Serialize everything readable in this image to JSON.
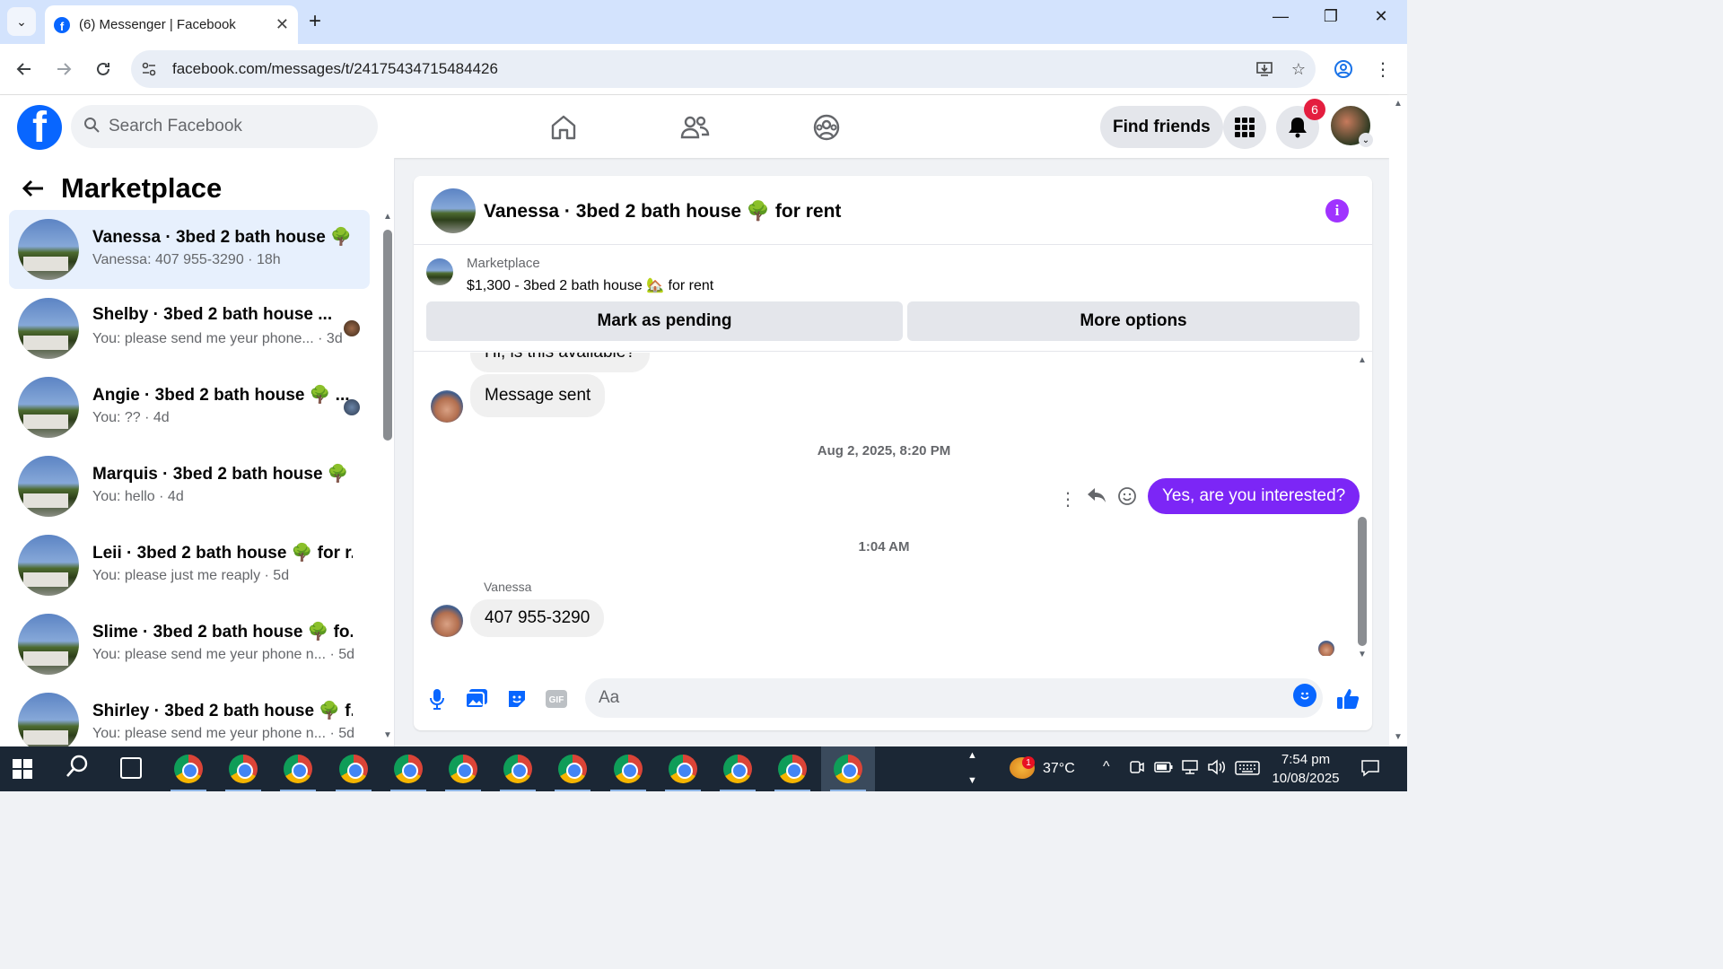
{
  "browser": {
    "tab_title": "(6) Messenger | Facebook",
    "url": "facebook.com/messages/t/24175434715484426"
  },
  "fb_header": {
    "search_placeholder": "Search Facebook",
    "find_friends": "Find friends",
    "notification_count": "6"
  },
  "left_panel": {
    "title": "Marketplace",
    "conversations": [
      {
        "name": "Vanessa · 3bed 2 bath house 🌳 ...",
        "snippet": "Vanessa: 407 955-3290 · 18h",
        "active": true
      },
      {
        "name": "Shelby · 3bed 2 bath house ...",
        "snippet": "You: please send me yeur phone... · 3d"
      },
      {
        "name": "Angie · 3bed 2 bath house 🌳 ...",
        "snippet": "You: ?? · 4d"
      },
      {
        "name": "Marquis · 3bed 2 bath house 🌳 ...",
        "snippet": "You: hello · 4d"
      },
      {
        "name": "Leii · 3bed 2 bath house 🌳 for r...",
        "snippet": "You: please just me reaply · 5d"
      },
      {
        "name": "Slime · 3bed 2 bath house 🌳 fo...",
        "snippet": "You: please send me yeur phone n...  · 5d"
      },
      {
        "name": "Shirley · 3bed 2 bath house 🌳 f...",
        "snippet": "You: please send me yeur phone n...  · 5d"
      }
    ]
  },
  "chat": {
    "title": "Vanessa · 3bed 2 bath house 🌳 for rent",
    "listing_source": "Marketplace",
    "listing_desc": "$1,300 - 3bed 2 bath house 🏡 for rent",
    "mark_pending": "Mark as pending",
    "more_options": "More options",
    "partial_msg": "Hi, is this available?",
    "msg_sent": "Message sent",
    "ts1": "Aug 2, 2025, 8:20 PM",
    "out_msg": "Yes, are you interested?",
    "ts2": "1:04 AM",
    "sender_name": "Vanessa",
    "in_msg": "407 955-3290",
    "composer_placeholder": "Aa"
  },
  "taskbar": {
    "temperature": "37°C",
    "weather_badge": "1",
    "time": "7:54 pm",
    "date": "10/08/2025"
  },
  "colors": {
    "fb_blue": "#0866ff",
    "messenger_purple": "#7c26f6",
    "active_conv": "#e7f0fd"
  }
}
